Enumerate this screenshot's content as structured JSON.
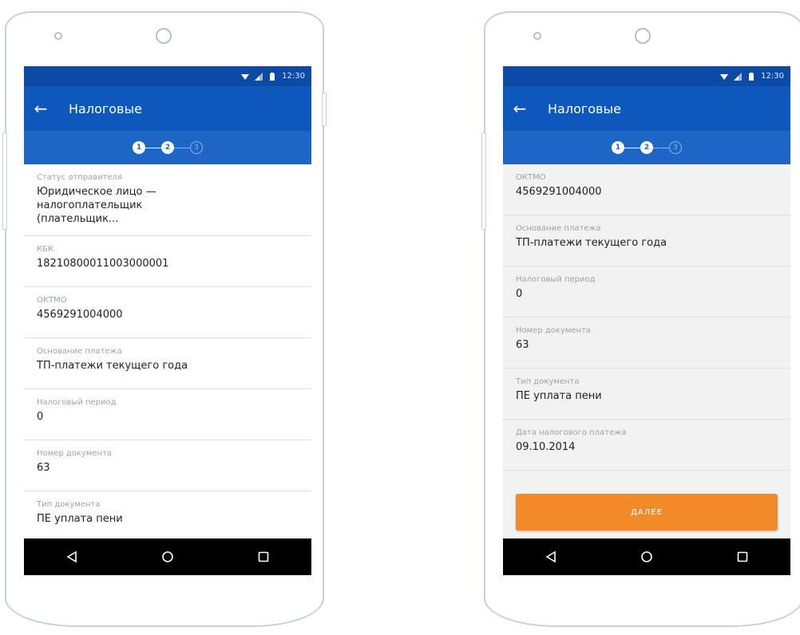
{
  "status_bar": {
    "time": "12:30"
  },
  "app_bar": {
    "title": "Налоговые"
  },
  "stepper": {
    "steps": [
      "1",
      "2",
      "3"
    ],
    "current": 2
  },
  "left_screen": {
    "fields": [
      {
        "label": "Статус отправителя",
        "value": "Юридическое лицо — налогоплательщик (плательщик..."
      },
      {
        "label": "КБК",
        "value": "18210800011003000001"
      },
      {
        "label": "ОКТМО",
        "value": "4569291004000"
      },
      {
        "label": "Основание платежа",
        "value": "ТП-платежи текущего года"
      },
      {
        "label": "Налоговый период",
        "value": "0"
      },
      {
        "label": "Номер документа",
        "value": "63"
      },
      {
        "label": "Тип документа",
        "value": "ПЕ уплата пени"
      }
    ]
  },
  "right_screen": {
    "fields": [
      {
        "label": "ОКТМО",
        "value": "4569291004000"
      },
      {
        "label": "Основание платежа",
        "value": "ТП-платежи текущего года"
      },
      {
        "label": "Налоговый период",
        "value": "0"
      },
      {
        "label": "Номер документа",
        "value": "63"
      },
      {
        "label": "Тип документа",
        "value": "ПЕ уплата пени"
      },
      {
        "label": "Дата налогового платежа",
        "value": "09.10.2014"
      }
    ],
    "next_button": "ДАЛЕЕ"
  },
  "icons": {
    "back": "arrow-left-icon",
    "wifi": "wifi-icon",
    "signal": "signal-icon",
    "battery": "battery-icon",
    "nav_back": "nav-back-icon",
    "nav_home": "nav-home-icon",
    "nav_recents": "nav-recents-icon"
  },
  "colors": {
    "status_bar": "#0b4aa5",
    "app_bar": "#0d57bd",
    "stepper_bar": "#1e66c6",
    "accent_button": "#f28a2a"
  }
}
